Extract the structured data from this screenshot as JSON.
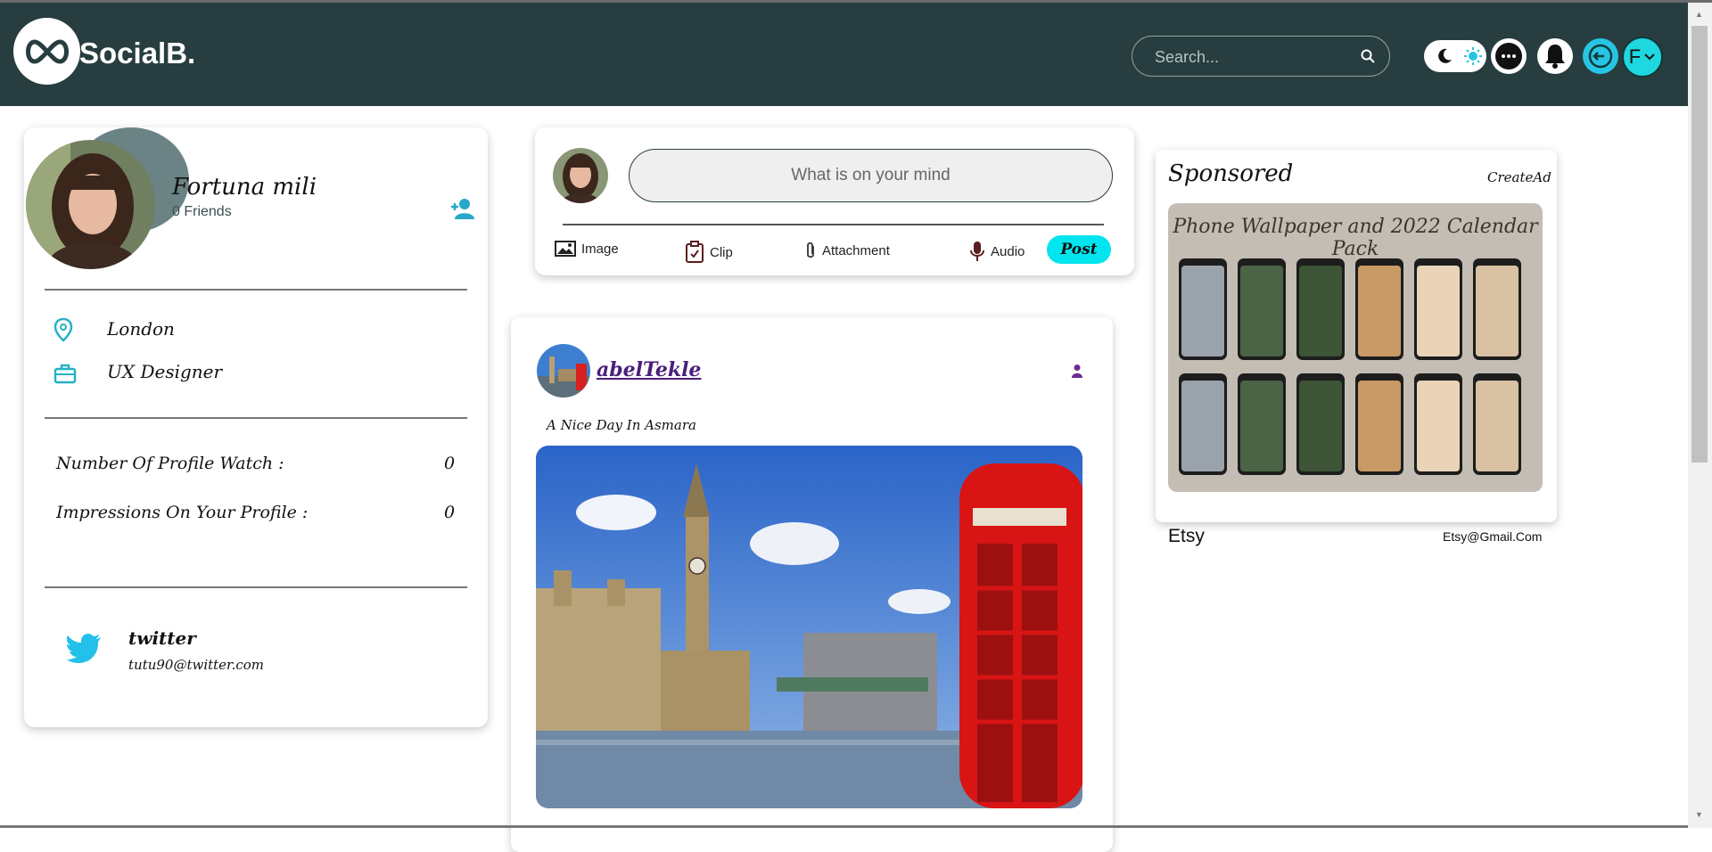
{
  "app": {
    "logo_text": "SocialB."
  },
  "navbar": {
    "search_placeholder": "Search...",
    "user_initial": "F",
    "colors": {
      "background": "#273d3f",
      "accent": "#1fd8df"
    },
    "icons": [
      "moon-icon",
      "sun-icon",
      "chat-icon",
      "bell-icon",
      "logout-icon",
      "chevron-down-icon"
    ]
  },
  "profile": {
    "name": "Fortuna mili",
    "friends": "0 Friends",
    "location": "London",
    "occupation": "UX Designer",
    "stats": [
      {
        "label": "Number Of Profile Watch :",
        "value": "0"
      },
      {
        "label": "Impressions On Your Profile :",
        "value": "0"
      }
    ],
    "social": {
      "network": "twitter",
      "handle": "tutu90@twitter.com"
    }
  },
  "composer": {
    "placeholder": "What is on your mind",
    "tools": {
      "image": "Image",
      "clip": "Clip",
      "attachment": "Attachment",
      "audio": "Audio"
    },
    "post_label": "Post"
  },
  "post": {
    "username": "abelTekle",
    "caption": "A Nice Day In Asmara"
  },
  "sponsored": {
    "title": "Sponsored",
    "create_ad": "CreateAd",
    "ad_image_title": "Phone Wallpaper and 2022 Calendar Pack",
    "advertiser": "Etsy",
    "email": "Etsy@Gmail.Com"
  }
}
